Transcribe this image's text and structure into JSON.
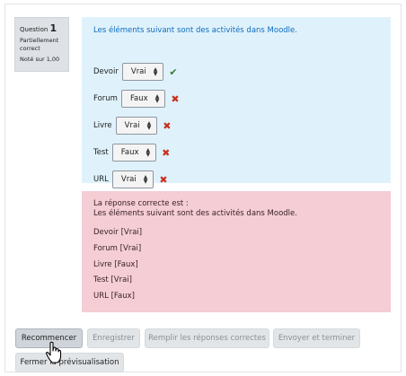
{
  "info": {
    "question_label": "Question",
    "question_number": "1",
    "state": "Partiellement correct",
    "grade": "Noté sur 1,00"
  },
  "question": {
    "text": "Les éléments suivant sont des activités dans Moodle.",
    "items": [
      {
        "label": "Devoir",
        "value": "Vrai",
        "status": "correct"
      },
      {
        "label": "Forum",
        "value": "Faux",
        "status": "incorrect"
      },
      {
        "label": "Livre",
        "value": "Vrai",
        "status": "incorrect"
      },
      {
        "label": "Test",
        "value": "Faux",
        "status": "incorrect"
      },
      {
        "label": "URL",
        "value": "Vrai",
        "status": "incorrect"
      }
    ]
  },
  "feedback": {
    "heading": "La réponse correcte est :",
    "text": "Les éléments suivant sont des activités dans Moodle.",
    "answers": [
      "Devoir [Vrai]",
      "Forum [Vrai]",
      "Livre [Faux]",
      "Test [Vrai]",
      "URL [Faux]"
    ]
  },
  "buttons": {
    "restart": "Recommencer",
    "save": "Enregistrer",
    "fill_correct": "Remplir les réponses correctes",
    "submit_finish": "Envoyer et terminer",
    "close_preview": "Fermer la prévisualisation"
  },
  "icons": {
    "correct": "check-icon",
    "incorrect": "cross-icon",
    "select_arrows": "updown-icon",
    "cursor": "hand-pointer-icon"
  },
  "colors": {
    "correct": "#357a32",
    "incorrect": "#ca3120",
    "formulation_bg": "#dff2fb",
    "feedback_bg": "#f4cdd5",
    "link_text": "#0f6cbf"
  }
}
